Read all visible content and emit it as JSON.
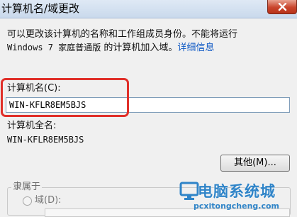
{
  "window": {
    "title": "计算机名/域更改"
  },
  "intro": {
    "line1": "可以更改该计算机的名称和工作组成员身份。不能将运行",
    "line2_os": "Windows 7 家庭普通版",
    "line2_rest": " 的计算机加入域。",
    "details_link": "详细信息"
  },
  "computer_name": {
    "label": "计算机名(C):",
    "value": "WIN-KFLR8EM5BJS"
  },
  "full_name": {
    "label": "计算机全名:",
    "value": "WIN-KFLR8EM5BJS"
  },
  "more_button": {
    "label": "其他(M)..."
  },
  "member_of": {
    "title": "隶属于",
    "domain_label": "域(D):",
    "domain_value": "",
    "domain_selected": false
  },
  "watermark": {
    "brand": "电脑系统城",
    "url": "pcxitongcheng.com"
  },
  "colors": {
    "highlight": "#e0302a",
    "link": "#0c57c4",
    "watermark": "#2f84c8"
  }
}
